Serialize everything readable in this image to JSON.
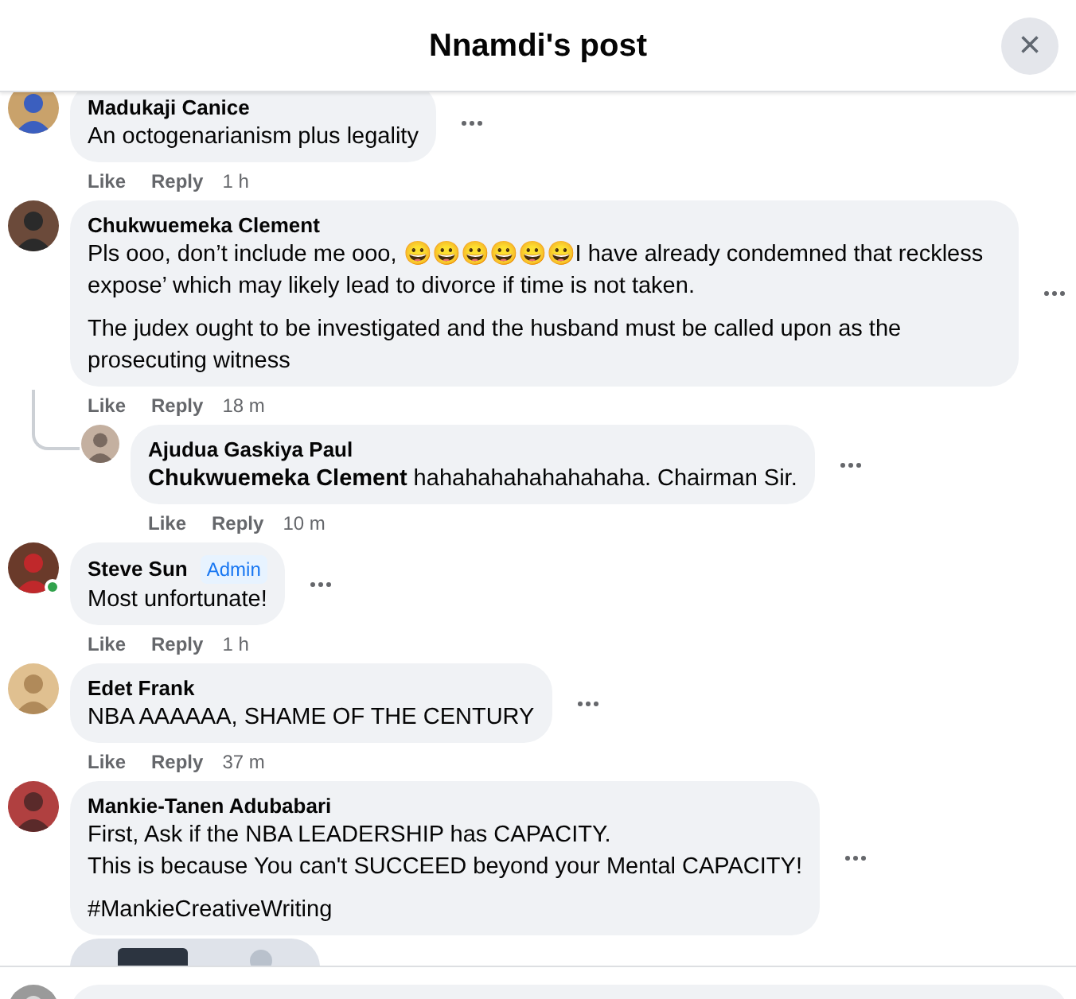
{
  "header": {
    "title": "Nnamdi's post",
    "close": "×"
  },
  "comments": [
    {
      "author": "Madukaji Canice",
      "paragraphs": [
        "An octogenarianism plus legality"
      ],
      "actions": [
        "Like",
        "Reply"
      ],
      "time": "1 h",
      "online": false
    },
    {
      "author": "Chukwuemeka Clement",
      "paragraphs": [
        "Pls ooo, don’t include me ooo, 😀😀😀😀😀😀I have already condemned that reckless expose’ which may likely lead to divorce if time is not taken.",
        "The judex ought to be investigated and the husband must be called upon as the prosecuting witness"
      ],
      "actions": [
        "Like",
        "Reply"
      ],
      "time": "18 m",
      "online": false,
      "children": [
        {
          "author": "Ajudua Gaskiya Paul",
          "paragraphs": [
            "**Chukwuemeka Clement** hahahahahahahahaha. Chairman Sir."
          ],
          "actions": [
            "Like",
            "Reply"
          ],
          "time": "10 m",
          "online": false
        }
      ]
    },
    {
      "author": "Steve Sun",
      "badge": "Admin",
      "paragraphs": [
        "Most unfortunate!"
      ],
      "actions": [
        "Like",
        "Reply"
      ],
      "time": "1 h",
      "online": true
    },
    {
      "author": "Edet Frank",
      "paragraphs": [
        "NBA AAAAAA, SHAME OF THE CENTURY"
      ],
      "actions": [
        "Like",
        "Reply"
      ],
      "time": "37 m",
      "online": false
    },
    {
      "author": "Mankie-Tanen Adubabari",
      "paragraphs": [
        "First, Ask if the NBA LEADERSHIP has CAPACITY.\nThis is because You can't SUCCEED beyond your Mental CAPACITY!",
        "#MankieCreativeWriting"
      ],
      "online": false
    }
  ]
}
